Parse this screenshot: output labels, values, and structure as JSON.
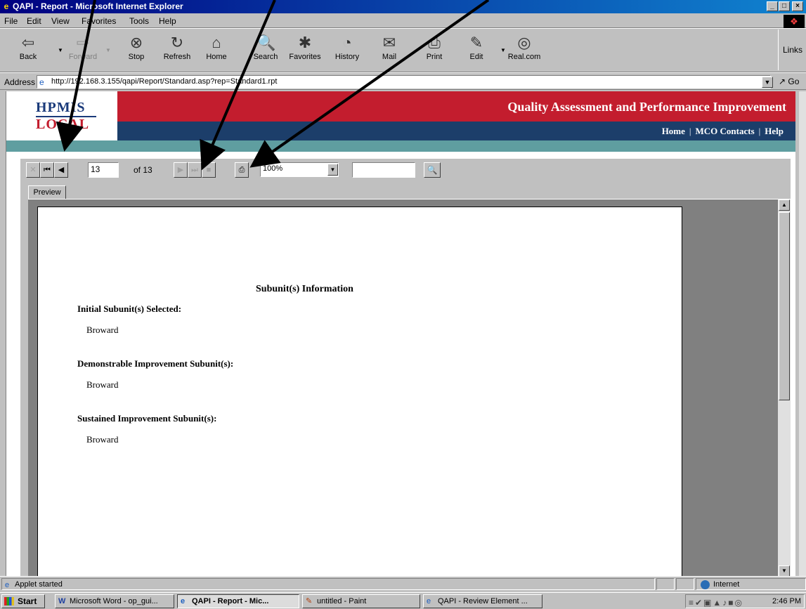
{
  "window": {
    "title": "QAPI - Report - Microsoft Internet Explorer",
    "buttons": [
      "_",
      "□",
      "×"
    ]
  },
  "menu": {
    "items": [
      "File",
      "Edit",
      "View",
      "Favorites",
      "Tools",
      "Help"
    ]
  },
  "toolbar": {
    "back": "Back",
    "forward": "Forward",
    "stop": "Stop",
    "refresh": "Refresh",
    "home": "Home",
    "search": "Search",
    "favorites": "Favorites",
    "history": "History",
    "mail": "Mail",
    "print": "Print",
    "edit": "Edit",
    "realcom": "Real.com",
    "links": "Links"
  },
  "address": {
    "label": "Address",
    "url": "http://192.168.3.155/qapi/Report/Standard.asp?rep=Standard1.rpt",
    "go": "Go"
  },
  "portal": {
    "logo_top": "HPMIS",
    "logo_bottom": "LOCAL",
    "title": "Quality Assessment and Performance Improvement",
    "nav": [
      "Home",
      "MCO Contacts",
      "Help"
    ]
  },
  "viewer": {
    "current_page": "13",
    "page_count_label": "of 13",
    "zoom": "100%",
    "search_value": "",
    "tab": "Preview"
  },
  "report": {
    "heading": "Subunit(s)  Information",
    "sections": [
      {
        "label": "Initial Subunit(s) Selected:",
        "value": "Broward"
      },
      {
        "label": "Demonstrable Improvement Subunit(s):",
        "value": "Broward"
      },
      {
        "label": "Sustained Improvement Subunit(s):",
        "value": "Broward"
      }
    ]
  },
  "status": {
    "text": "Applet started",
    "zone": "Internet"
  },
  "taskbar": {
    "start": "Start",
    "tasks": [
      "Microsoft Word - op_gui...",
      "QAPI - Report - Mic...",
      "untitled - Paint",
      "QAPI - Review Element ..."
    ],
    "clock": "2:46 PM"
  }
}
